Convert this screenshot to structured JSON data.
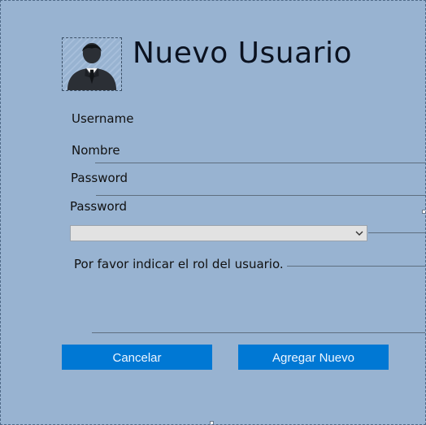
{
  "header": {
    "title": "Nuevo Usuario"
  },
  "fields": {
    "username_label": "Username",
    "nombre_label": "Nombre",
    "password_label": "Password",
    "password_confirm_label": "Password",
    "role_hint": "Por favor indicar el rol del usuario."
  },
  "role_select": {
    "value": ""
  },
  "buttons": {
    "cancel_label": "Cancelar",
    "add_label": "Agregar Nuevo"
  },
  "colors": {
    "background": "#98b3d1",
    "button": "#0078d4",
    "button_text": "#eef6ff"
  },
  "icons": {
    "avatar": "user-icon",
    "dropdown": "chevron-down-icon"
  }
}
